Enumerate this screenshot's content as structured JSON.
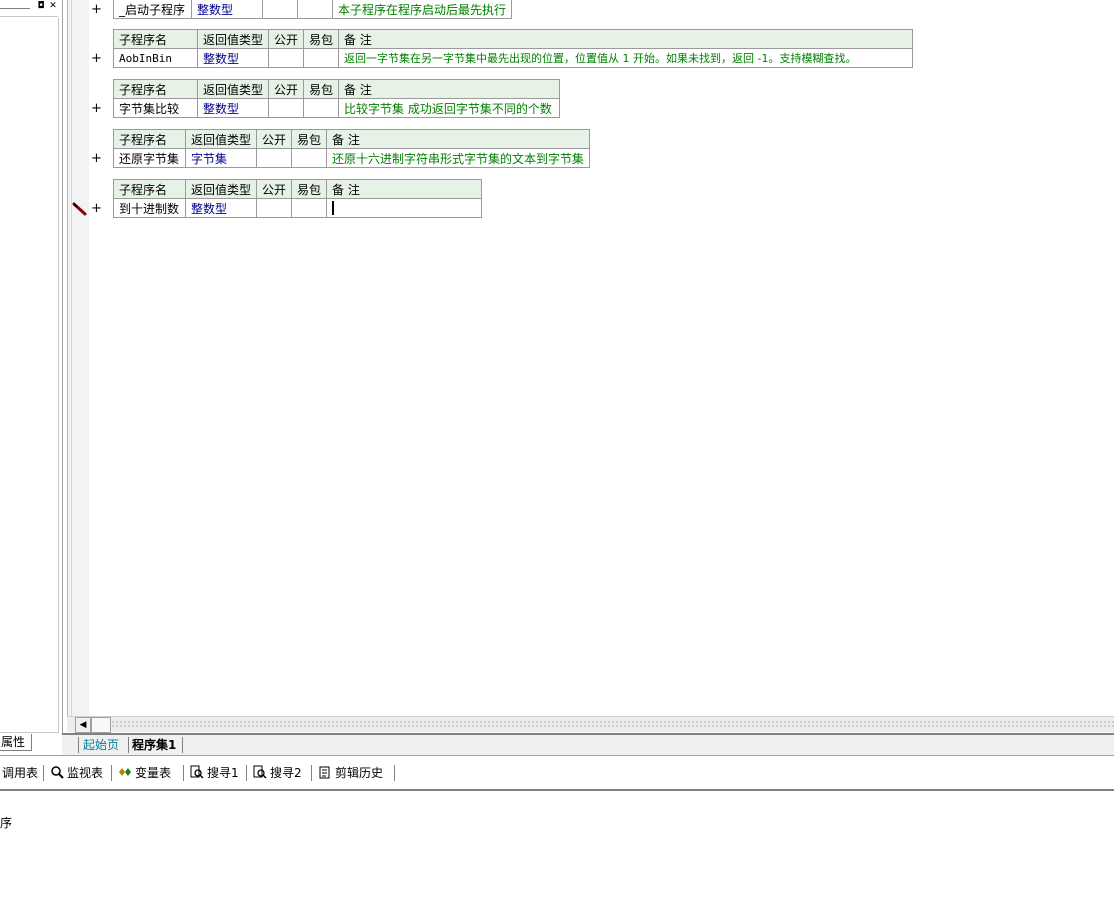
{
  "left_panel": {
    "pin_label": "◘",
    "close_label": "✕",
    "property_tab": "属性"
  },
  "tables": [
    {
      "name": "_启动子程序",
      "ret_type": "整数型",
      "public": "",
      "easy": "",
      "note": "本子程序在程序启动后最先执行",
      "show_header": false
    },
    {
      "header": {
        "name": "子程序名",
        "ret_type": "返回值类型",
        "public": "公开",
        "easy": "易包",
        "note": "备 注"
      },
      "name": "AobInBin",
      "ret_type": "整数型",
      "public": "",
      "easy": "",
      "note": "返回一字节集在另一字节集中最先出现的位置，位置值从 1 开始。如果未找到，返回 -1。支持模糊查找。"
    },
    {
      "header": {
        "name": "子程序名",
        "ret_type": "返回值类型",
        "public": "公开",
        "easy": "易包",
        "note": "备 注"
      },
      "name": "字节集比较",
      "ret_type": "整数型",
      "public": "",
      "easy": "",
      "note": "比较字节集 成功返回字节集不同的个数"
    },
    {
      "header": {
        "name": "子程序名",
        "ret_type": "返回值类型",
        "public": "公开",
        "easy": "易包",
        "note": "备 注"
      },
      "name": "还原字节集",
      "ret_type": "字节集",
      "public": "",
      "easy": "",
      "note": "还原十六进制字符串形式字节集的文本到字节集"
    },
    {
      "header": {
        "name": "子程序名",
        "ret_type": "返回值类型",
        "public": "公开",
        "easy": "易包",
        "note": "备 注"
      },
      "name": "到十进制数",
      "ret_type": "整数型",
      "public": "",
      "easy": "",
      "note": ""
    }
  ],
  "expand_symbol": "+",
  "doc_tabs": [
    "起始页",
    "程序集1"
  ],
  "bottom_toolbar": [
    "调用表",
    "监视表",
    "变量表",
    "搜寻1",
    "搜寻2",
    "剪辑历史"
  ],
  "output_text": "序",
  "colors": {
    "header_bg": "#e6f2e6",
    "type_color": "#00008b",
    "note_color": "#008000",
    "tab_link": "#0080a0"
  }
}
